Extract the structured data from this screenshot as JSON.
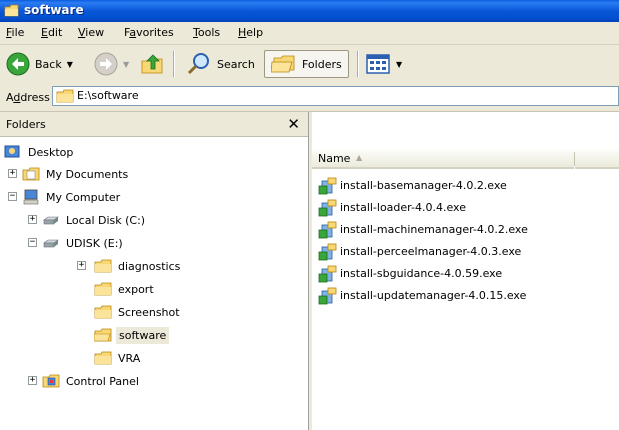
{
  "window": {
    "title": "software"
  },
  "menu": [
    {
      "label": "File",
      "accel": "F",
      "rest": "ile"
    },
    {
      "label": "Edit",
      "accel": "E",
      "rest": "dit"
    },
    {
      "label": "View",
      "accel": "V",
      "rest": "iew"
    },
    {
      "label": "Favorites",
      "accel": "a",
      "pre": "F",
      "rest": "vorites"
    },
    {
      "label": "Tools",
      "accel": "T",
      "rest": "ools"
    },
    {
      "label": "Help",
      "accel": "H",
      "rest": "elp"
    }
  ],
  "toolbar": {
    "back_label": "Back",
    "search_label": "Search",
    "folders_label": "Folders"
  },
  "address": {
    "label_pre": "A",
    "label_accel": "d",
    "label_rest": "dress",
    "value": "E:\\software"
  },
  "folders_pane": {
    "title": "Folders",
    "close_glyph": "✕",
    "items": [
      {
        "label": "Desktop"
      },
      {
        "label": "My Documents"
      },
      {
        "label": "My Computer"
      },
      {
        "label": "Local Disk (C:)"
      },
      {
        "label": "UDISK (E:)"
      },
      {
        "label": "diagnostics"
      },
      {
        "label": "export"
      },
      {
        "label": "Screenshot"
      },
      {
        "label": "software"
      },
      {
        "label": "VRA"
      },
      {
        "label": "Control Panel"
      }
    ]
  },
  "files_pane": {
    "column_name": "Name",
    "files": [
      "install-basemanager-4.0.2.exe",
      "install-loader-4.0.4.exe",
      "install-machinemanager-4.0.2.exe",
      "install-perceelmanager-4.0.3.exe",
      "install-sbguidance-4.0.59.exe",
      "install-updatemanager-4.0.15.exe"
    ]
  }
}
